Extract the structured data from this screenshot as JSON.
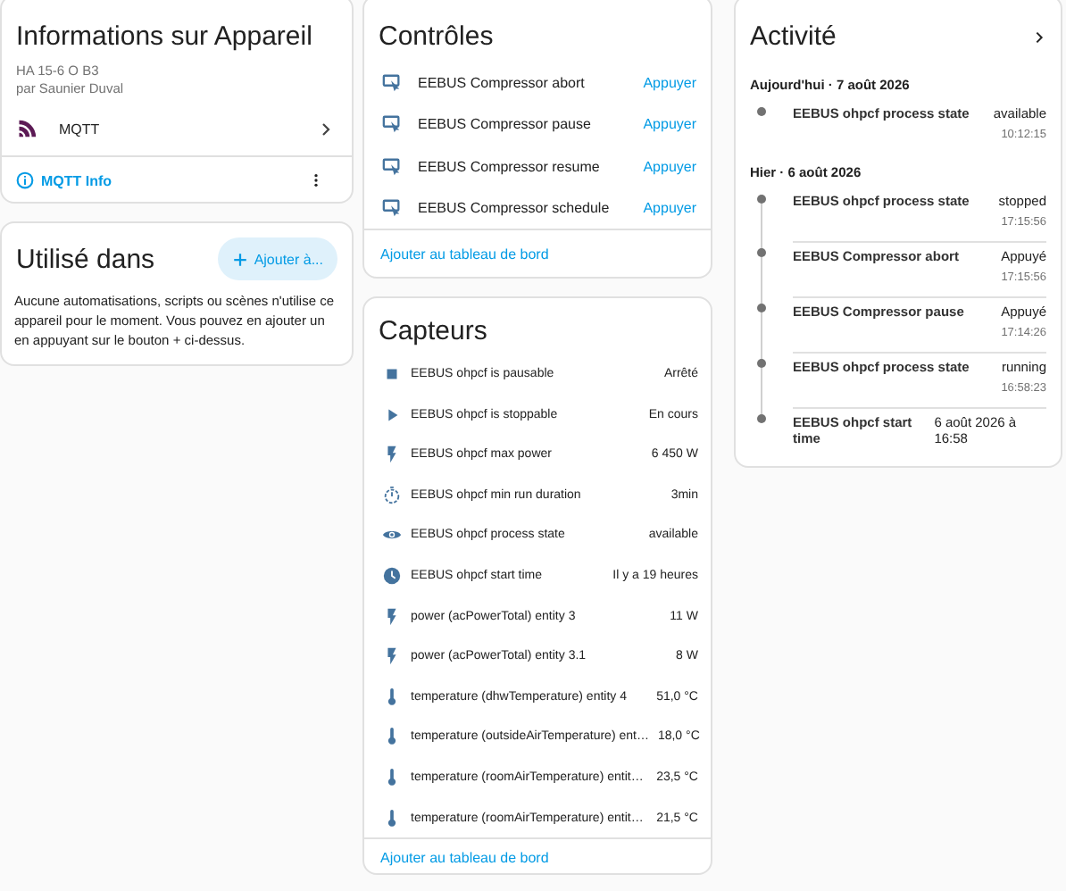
{
  "device": {
    "title": "Informations sur Appareil",
    "model": "HA 15-6 O B3",
    "manufacturer": "par Saunier Duval",
    "integration": "MQTT",
    "info_link": "MQTT Info"
  },
  "used_in": {
    "title": "Utilisé dans",
    "add_button": "Ajouter à...",
    "description": "Aucune automatisations, scripts ou scènes n'utilise ce appareil pour le moment. Vous pouvez en ajouter un en appuyant sur le bouton + ci-dessus."
  },
  "controls": {
    "title": "Contrôles",
    "items": [
      {
        "name": "EEBUS Compressor abort",
        "action": "Appuyer"
      },
      {
        "name": "EEBUS Compressor pause",
        "action": "Appuyer"
      },
      {
        "name": "EEBUS Compressor resume",
        "action": "Appuyer"
      },
      {
        "name": "EEBUS Compressor schedule",
        "action": "Appuyer"
      }
    ],
    "footer_link": "Ajouter au tableau de bord"
  },
  "sensors": {
    "title": "Capteurs",
    "items": [
      {
        "kind": "stop",
        "name": "EEBUS ohpcf is pausable",
        "value": "Arrêté"
      },
      {
        "kind": "play",
        "name": "EEBUS ohpcf is stoppable",
        "value": "En cours"
      },
      {
        "kind": "flash",
        "name": "EEBUS ohpcf max power",
        "value": "6 450 W"
      },
      {
        "kind": "timer",
        "name": "EEBUS ohpcf min run duration",
        "value": "3min"
      },
      {
        "kind": "eye",
        "name": "EEBUS ohpcf process state",
        "value": "available"
      },
      {
        "kind": "clock",
        "name": "EEBUS ohpcf start time",
        "value": "Il y a 19 heures"
      },
      {
        "kind": "flash",
        "name": "power (acPowerTotal) entity 3",
        "value": "11 W"
      },
      {
        "kind": "flash",
        "name": "power (acPowerTotal) entity 3.1",
        "value": "8 W"
      },
      {
        "kind": "thermometer",
        "name": "temperature (dhwTemperature) entity 4",
        "value": "51,0 °C"
      },
      {
        "kind": "thermometer",
        "name": "temperature (outsideAirTemperature) ent…",
        "value": "18,0 °C"
      },
      {
        "kind": "thermometer",
        "name": "temperature (roomAirTemperature) entit…",
        "value": "23,5 °C"
      },
      {
        "kind": "thermometer",
        "name": "temperature (roomAirTemperature) entit…",
        "value": "21,5 °C"
      }
    ],
    "footer_link": "Ajouter au tableau de bord"
  },
  "activity": {
    "title": "Activité",
    "groups": [
      {
        "date": "Aujourd'hui · 7 août 2026",
        "entries": [
          {
            "name": "EEBUS ohpcf process state",
            "state": "available",
            "time": "10:12:15"
          }
        ]
      },
      {
        "date": "Hier · 6 août 2026",
        "entries": [
          {
            "name": "EEBUS ohpcf process state",
            "state": "stopped",
            "time": "17:15:56"
          },
          {
            "name": "EEBUS Compressor abort",
            "state": "Appuyé",
            "time": "17:15:56"
          },
          {
            "name": "EEBUS Compressor pause",
            "state": "Appuyé",
            "time": "17:14:26"
          },
          {
            "name": "EEBUS ohpcf process state",
            "state": "running",
            "time": "16:58:23"
          },
          {
            "name": "EEBUS ohpcf start time",
            "state": "6 août 2026 à 16:58"
          }
        ]
      }
    ]
  }
}
